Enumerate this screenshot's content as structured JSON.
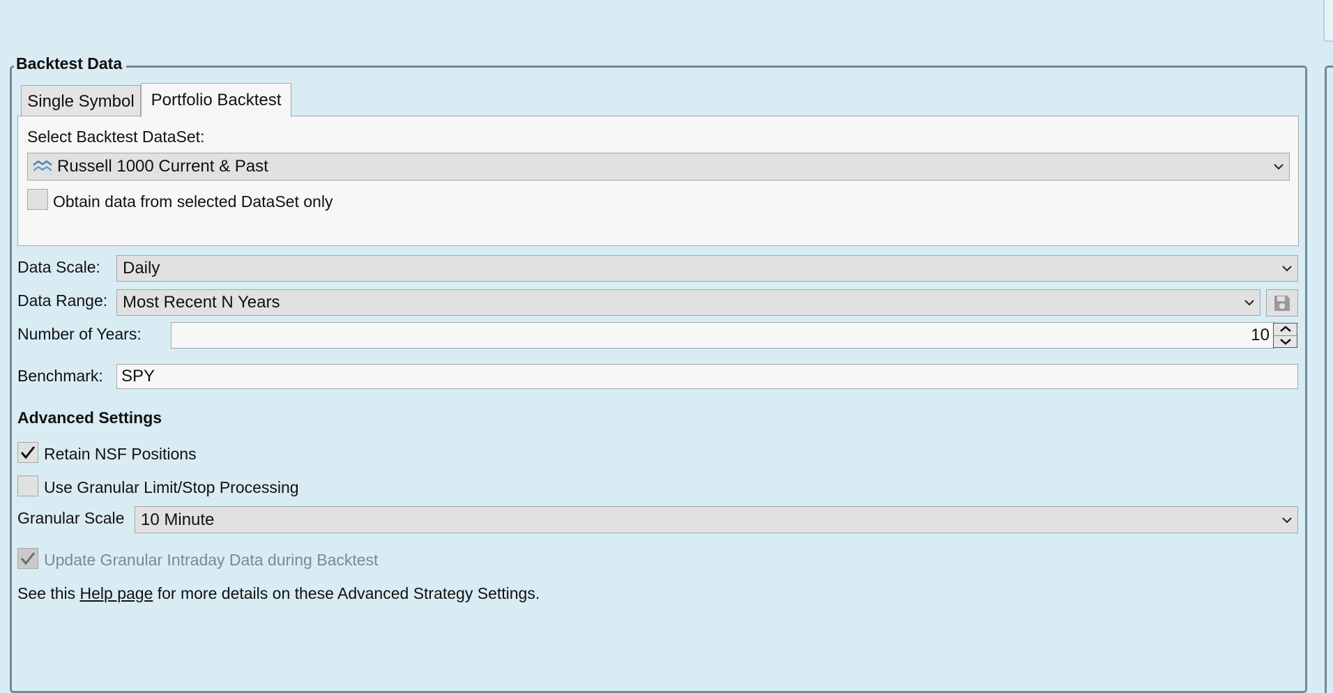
{
  "group": {
    "title": "Backtest Data"
  },
  "tabs": [
    {
      "label": "Single Symbol",
      "active": false
    },
    {
      "label": "Portfolio Backtest",
      "active": true
    }
  ],
  "dataset": {
    "label": "Select Backtest DataSet:",
    "selected": "Russell 1000 Current & Past",
    "icon": "dataset-icon",
    "only_checkbox": {
      "label": "Obtain data from selected DataSet only",
      "checked": false
    }
  },
  "data_scale": {
    "label": "Data Scale:",
    "selected": "Daily"
  },
  "data_range": {
    "label": "Data Range:",
    "selected": "Most Recent N Years",
    "save_icon": "save-icon"
  },
  "years": {
    "label": "Number of Years:",
    "value": "10"
  },
  "benchmark": {
    "label": "Benchmark:",
    "value": "SPY"
  },
  "advanced": {
    "title": "Advanced Settings",
    "retain_nsf": {
      "label": "Retain NSF Positions",
      "checked": true
    },
    "granular": {
      "label": "Use Granular Limit/Stop Processing",
      "checked": false
    },
    "granular_scale": {
      "label": "Granular Scale",
      "selected": "10 Minute"
    },
    "update_intraday": {
      "label": "Update Granular Intraday Data during Backtest",
      "checked": true,
      "disabled": true
    },
    "help": {
      "prefix": "See this ",
      "link": "Help page",
      "suffix": " for more details on these Advanced Strategy Settings."
    }
  },
  "colors": {
    "background": "#d9ecf4",
    "border": "#6f8a99",
    "control": "#e1e1e1",
    "dataset_icon": "#4a7fb0"
  }
}
